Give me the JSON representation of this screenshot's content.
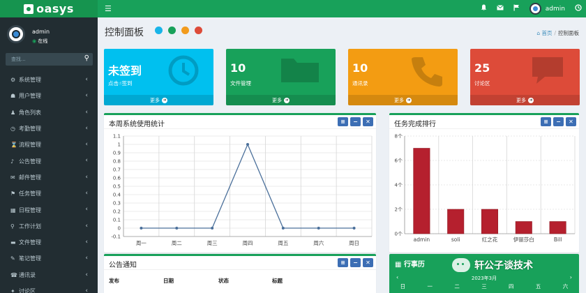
{
  "app": {
    "brand": "oasys"
  },
  "topbar": {
    "user": "admin"
  },
  "sidebar": {
    "user_name": "admin",
    "user_status": "在线",
    "search_placeholder": "查找...",
    "items": [
      {
        "label": "系统管理",
        "icon": "gear-icon",
        "glyph": "⚙"
      },
      {
        "label": "用户管理",
        "icon": "users-icon",
        "glyph": "☗"
      },
      {
        "label": "角色列表",
        "icon": "user-icon",
        "glyph": "♟"
      },
      {
        "label": "考勤管理",
        "icon": "clock-icon",
        "glyph": "◷"
      },
      {
        "label": "流程管理",
        "icon": "hourglass-icon",
        "glyph": "⌛"
      },
      {
        "label": "公告管理",
        "icon": "bell-icon",
        "glyph": "♪"
      },
      {
        "label": "邮件管理",
        "icon": "mail-icon",
        "glyph": "✉"
      },
      {
        "label": "任务管理",
        "icon": "flag-icon",
        "glyph": "⚑"
      },
      {
        "label": "日程管理",
        "icon": "calendar-icon",
        "glyph": "▦"
      },
      {
        "label": "工作计划",
        "icon": "person-icon",
        "glyph": "⚲"
      },
      {
        "label": "文件管理",
        "icon": "folder-icon",
        "glyph": "▬"
      },
      {
        "label": "笔记管理",
        "icon": "pencil-icon",
        "glyph": "✎"
      },
      {
        "label": "通讯录",
        "icon": "phone-icon",
        "glyph": "☎"
      },
      {
        "label": "讨论区",
        "icon": "comment-icon",
        "glyph": "✦"
      }
    ]
  },
  "header": {
    "title": "控制面板",
    "dots": [
      "#18b4e8",
      "#18a15a",
      "#f29b1d",
      "#dd4b39"
    ],
    "breadcrumb_home": "首页",
    "breadcrumb_current": "控制面板"
  },
  "boxes": [
    {
      "value": "未签到",
      "label": "点击☝签到",
      "more": "更多",
      "color": "#00c0ef",
      "icon": "clock-icon"
    },
    {
      "value": "10",
      "label": "文件管理",
      "more": "更多",
      "color": "#18a15a",
      "icon": "folder-icon"
    },
    {
      "value": "10",
      "label": "通讯录",
      "more": "更多",
      "color": "#f39c12",
      "icon": "phone-icon"
    },
    {
      "value": "25",
      "label": "讨论区",
      "more": "更多",
      "color": "#dd4b39",
      "icon": "comment-icon"
    }
  ],
  "panels": {
    "weekly_title": "本周系统使用统计",
    "rank_title": "任务完成排行",
    "notice_title": "公告通知",
    "calendar_title": "行事历"
  },
  "notice_table": {
    "columns": [
      "发布",
      "日期",
      "状态",
      "标题"
    ]
  },
  "calendar": {
    "month": "2023年3月",
    "weekdays": [
      "日",
      "一",
      "二",
      "三",
      "四",
      "五",
      "六"
    ]
  },
  "watermark": "轩公子谈技术",
  "chart_data": [
    {
      "type": "line",
      "title": "本周系统使用统计",
      "categories": [
        "周一",
        "周二",
        "周三",
        "周四",
        "周五",
        "周六",
        "周日"
      ],
      "series": [
        {
          "values": [
            0,
            0,
            0,
            1,
            0,
            0,
            0
          ]
        }
      ],
      "ylim": [
        -0.1,
        1.1
      ],
      "yticks": [
        "-0.1",
        "0",
        "0.1",
        "0.2",
        "0.3",
        "0.4",
        "0.5",
        "0.6",
        "0.7",
        "0.8",
        "0.9",
        "1",
        "1.1"
      ],
      "color": "#4a6f9a",
      "grid": true
    },
    {
      "type": "bar",
      "title": "任务完成排行",
      "categories": [
        "admin",
        "soli",
        "红之花",
        "伊丽莎白",
        "Bill"
      ],
      "values": [
        7,
        2,
        2,
        1,
        1
      ],
      "ylim": [
        0,
        8
      ],
      "yticks": [
        "0个",
        "2个",
        "4个",
        "6个",
        "8个"
      ],
      "color": "#b5202e",
      "grid": true
    }
  ]
}
